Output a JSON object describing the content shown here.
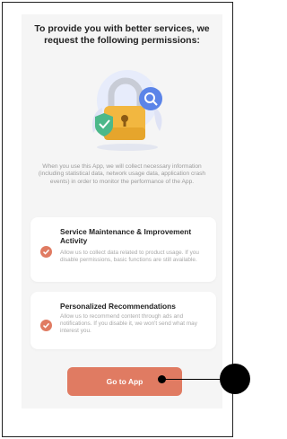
{
  "dialog": {
    "title": "To provide you with better services, we request the following permissions:",
    "description": "When you use this App, we will collect necessary information (including statistical data, network usage data, application crash events) in order to monitor the performance of the App."
  },
  "permissions": [
    {
      "title": "Service Maintenance & Improvement Activity",
      "description": "Allow us to collect data related to product usage. If you disable permissions, basic functions are still available.",
      "checked": true
    },
    {
      "title": "Personalized Recommendations",
      "description": "Allow us to recommend content through ads and notifications. If you disable it, we won't send what may interest you.",
      "checked": true
    }
  ],
  "actions": {
    "go_to_app_label": "Go to App"
  },
  "colors": {
    "accent": "#e07b62",
    "card_background": "#f5f5f5",
    "illustration_blue": "#5b84e8",
    "illustration_lock": "#f2b740"
  },
  "icons": [
    "lock-icon",
    "shield-check-icon",
    "magnifier-icon",
    "checkmark-icon"
  ]
}
